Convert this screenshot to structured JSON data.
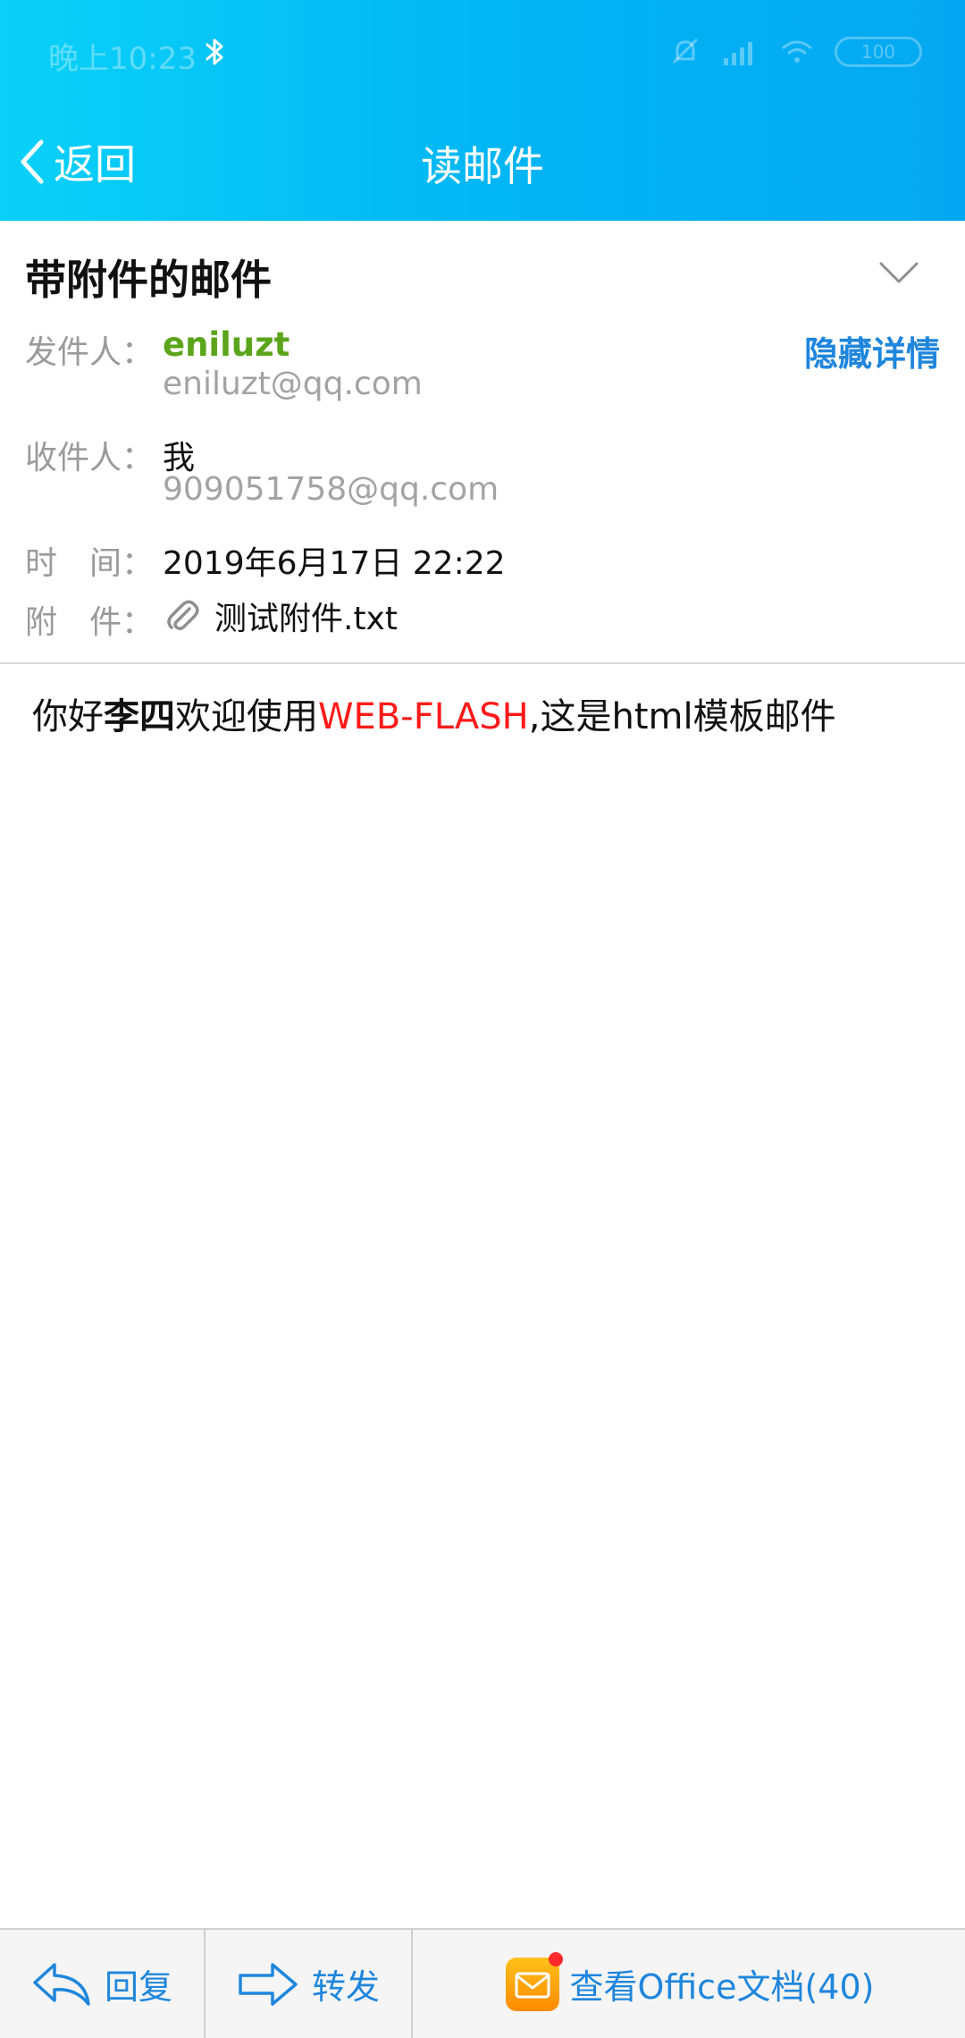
{
  "status_bar": {
    "time": "晚上10:23",
    "battery": "100"
  },
  "nav": {
    "back_label": "返回",
    "title": "读邮件"
  },
  "mail": {
    "subject": "带附件的邮件",
    "toggle_details_label": "隐藏详情",
    "sender": {
      "label": "发件人：",
      "name": "eniluzt",
      "address": "eniluzt@qq.com"
    },
    "recipient": {
      "label": "收件人：",
      "name": "我",
      "address": "909051758@qq.com"
    },
    "time": {
      "label": "时　间：",
      "value": "2019年6月17日 22:22"
    },
    "attachment": {
      "label": "附　件：",
      "name": "测试附件.txt"
    },
    "body": {
      "part1": "你好",
      "part2_bold": "李四",
      "part3": "欢迎使用",
      "part4_red": "WEB-FLASH",
      "part5": ",这是html模板邮件"
    }
  },
  "bottom_bar": {
    "reply_label": "回复",
    "forward_label": "转发",
    "office_label": "查看Office文档(40)"
  },
  "colors": {
    "accent": "#1f86dd",
    "header_gradient_start": "#0ad1f8",
    "header_gradient_end": "#04a8f2",
    "sender_name": "#5aa51a",
    "highlight_red": "#ff1a1a"
  },
  "icons": {
    "back": "chevron-left-icon",
    "bluetooth": "bluetooth-icon",
    "signal": "signal-icon",
    "wifi": "wifi-icon",
    "mute": "bell-off-icon",
    "expand": "chevron-down-icon",
    "attachment": "paperclip-icon",
    "reply": "reply-arrow-icon",
    "forward": "forward-arrow-icon",
    "office": "mail-envelope-icon"
  }
}
